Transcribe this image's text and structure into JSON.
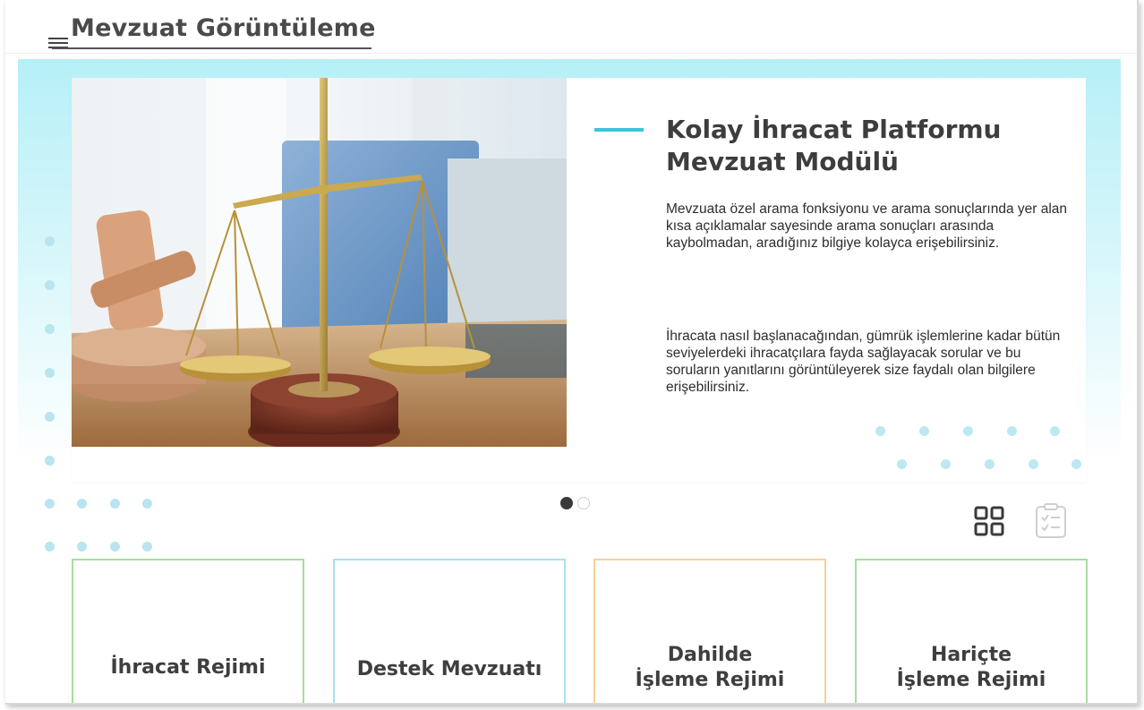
{
  "header": {
    "title": "Mevzuat Görüntüleme"
  },
  "slider": {
    "heading": "Kolay İhracat Platformu Mevzuat Modülü",
    "paragraph1": "Mevzuata özel arama fonksiyonu ve arama sonuçlarında yer alan kısa açıklamalar sayesinde arama sonuçları arasında kaybolmadan, aradığınız bilgiye kolayca erişebilirsiniz.",
    "paragraph2": "İhracata nasıl başlanacağından, gümrük işlemlerine kadar bütün seviyelerdeki ihracatçılara fayda sağlayacak sorular ve bu soruların yanıtlarını görüntüleyerek size faydalı olan bilgilere erişebilirsiniz.",
    "pages": [
      {
        "active": true
      },
      {
        "active": false
      }
    ],
    "accent_color": "#3fc3df"
  },
  "view_toggle": {
    "grid_icon": "grid-view-icon",
    "list_icon": "checklist-view-icon"
  },
  "cards": [
    {
      "label": "İhracat Rejimi",
      "border_color": "#a8dca0"
    },
    {
      "label": "Destek Mevzuatı",
      "border_color": "#a6e3ec"
    },
    {
      "label": "Dahilde İşleme Rejimi",
      "border_color": "#f8d290"
    },
    {
      "label": "Hariçte İşleme Rejimi",
      "border_color": "#a8dca0"
    }
  ]
}
